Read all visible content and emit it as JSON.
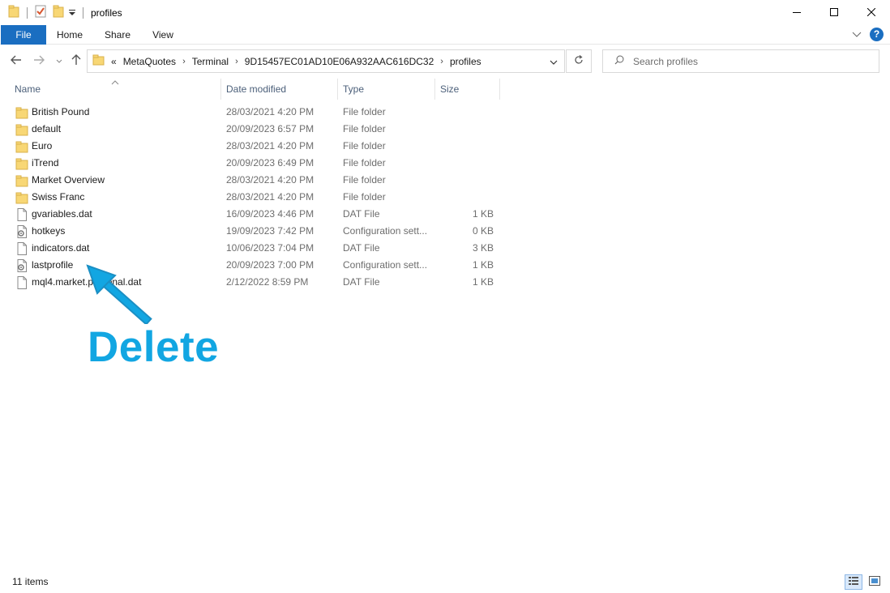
{
  "window": {
    "title": "profiles",
    "minimize_icon": "minimize-icon",
    "maximize_icon": "maximize-icon",
    "close_icon": "close-icon"
  },
  "ribbon": {
    "tabs": [
      {
        "label": "File"
      },
      {
        "label": "Home"
      },
      {
        "label": "Share"
      },
      {
        "label": "View"
      }
    ],
    "help": "?"
  },
  "address": {
    "overflow": "«",
    "parts": [
      "MetaQuotes",
      "Terminal",
      "9D15457EC01AD10E06A932AAC616DC32",
      "profiles"
    ]
  },
  "search": {
    "placeholder": "Search profiles"
  },
  "columns": {
    "name": "Name",
    "date": "Date modified",
    "type": "Type",
    "size": "Size"
  },
  "files": [
    {
      "name": "British Pound",
      "date": "28/03/2021 4:20 PM",
      "type": "File folder",
      "size": "",
      "icon": "folder-icon"
    },
    {
      "name": "default",
      "date": "20/09/2023 6:57 PM",
      "type": "File folder",
      "size": "",
      "icon": "folder-icon"
    },
    {
      "name": "Euro",
      "date": "28/03/2021 4:20 PM",
      "type": "File folder",
      "size": "",
      "icon": "folder-icon"
    },
    {
      "name": "iTrend",
      "date": "20/09/2023 6:49 PM",
      "type": "File folder",
      "size": "",
      "icon": "folder-icon"
    },
    {
      "name": "Market Overview",
      "date": "28/03/2021 4:20 PM",
      "type": "File folder",
      "size": "",
      "icon": "folder-icon"
    },
    {
      "name": "Swiss Franc",
      "date": "28/03/2021 4:20 PM",
      "type": "File folder",
      "size": "",
      "icon": "folder-icon"
    },
    {
      "name": "gvariables.dat",
      "date": "16/09/2023 4:46 PM",
      "type": "DAT File",
      "size": "1 KB",
      "icon": "file-icon"
    },
    {
      "name": "hotkeys",
      "date": "19/09/2023 7:42 PM",
      "type": "Configuration sett...",
      "size": "0 KB",
      "icon": "config-file-icon"
    },
    {
      "name": "indicators.dat",
      "date": "10/06/2023 7:04 PM",
      "type": "DAT File",
      "size": "3 KB",
      "icon": "file-icon"
    },
    {
      "name": "lastprofile",
      "date": "20/09/2023 7:00 PM",
      "type": "Configuration sett...",
      "size": "1 KB",
      "icon": "config-file-icon"
    },
    {
      "name": "mql4.market.personal.dat",
      "date": "2/12/2022 8:59 PM",
      "type": "DAT File",
      "size": "1 KB",
      "icon": "file-icon"
    }
  ],
  "annotation": {
    "text": "Delete",
    "color": "#12a6e2"
  },
  "status": {
    "count": "11 items"
  },
  "colors": {
    "accent": "#1a6ec1",
    "folder": "#f8d775"
  }
}
